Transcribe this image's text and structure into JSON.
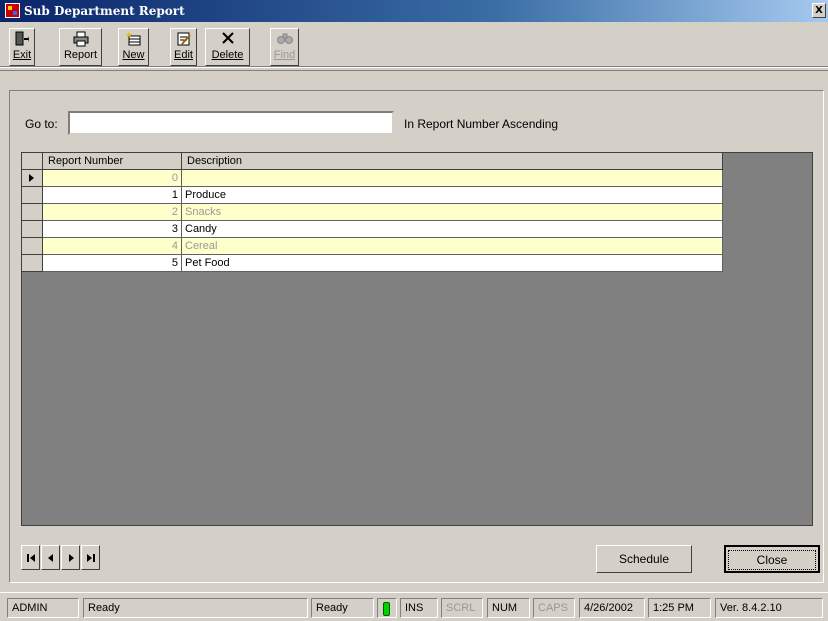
{
  "window": {
    "title": "Sub Department Report",
    "close_glyph": "X"
  },
  "toolbar": {
    "exit": "Exit",
    "report": "Report",
    "new": "New",
    "edit": "Edit",
    "delete": "Delete",
    "find": "Find",
    "icons": {
      "exit": "door-exit-icon",
      "report": "printer-icon",
      "new": "new-record-icon",
      "edit": "edit-icon",
      "delete": "x-delete-icon",
      "find": "binoculars-icon"
    }
  },
  "goto": {
    "label": "Go to:",
    "value": "",
    "sort_text": "In Report Number Ascending"
  },
  "grid": {
    "columns": [
      "Report Number",
      "Description"
    ],
    "rows": [
      {
        "number": "0",
        "description": ""
      },
      {
        "number": "1",
        "description": "Produce"
      },
      {
        "number": "2",
        "description": "Snacks"
      },
      {
        "number": "3",
        "description": "Candy"
      },
      {
        "number": "4",
        "description": "Cereal"
      },
      {
        "number": "5",
        "description": "Pet Food"
      }
    ]
  },
  "buttons": {
    "schedule": "Schedule",
    "close": "Close"
  },
  "statusbar": {
    "user": "ADMIN",
    "message": "Ready",
    "state": "Ready",
    "ins": "INS",
    "scrl": "SCRL",
    "num": "NUM",
    "caps": "CAPS",
    "date": "4/26/2002",
    "time": "1:25 PM",
    "version": "Ver. 8.4.2.10"
  },
  "colors": {
    "title_bar": "#0a246a",
    "row_highlight": "#ffffcc",
    "grid_background": "#808080",
    "led": "#00d000"
  }
}
